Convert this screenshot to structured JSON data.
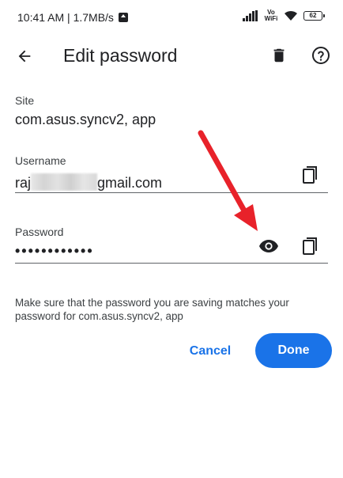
{
  "status_bar": {
    "time_speed": "10:41 AM | 1.7MB/s",
    "vowifi_top": "Vo",
    "vowifi_bottom": "WiFi",
    "battery": "62"
  },
  "app_bar": {
    "title": "Edit password",
    "back_icon": "arrow-back-icon",
    "delete_icon": "trash-icon",
    "help_icon": "help-circle-icon"
  },
  "site": {
    "label": "Site",
    "value": "com.asus.syncv2, app"
  },
  "username": {
    "label": "Username",
    "value_prefix": "raj",
    "value_suffix": "gmail.com",
    "copy_icon": "copy-icon"
  },
  "password": {
    "label": "Password",
    "value": "••••••••••••",
    "eye_icon": "eye-icon",
    "copy_icon": "copy-icon"
  },
  "info": {
    "text": "Make sure that the password you are saving matches your password for com.asus.syncv2, app"
  },
  "actions": {
    "cancel_label": "Cancel",
    "done_label": "Done"
  },
  "colors": {
    "accent": "#1a73e8",
    "annotation_arrow": "#e8222a"
  }
}
